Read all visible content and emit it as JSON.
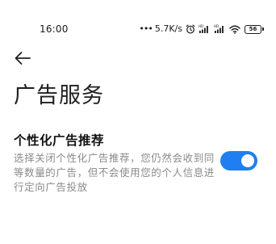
{
  "status_bar": {
    "time": "16:00",
    "dots": "•••",
    "net_speed": "5.7K/s",
    "alarm_icon": "alarm-icon",
    "signal_icons": [
      "signal-hd-icon",
      "signal-hd-icon"
    ],
    "wifi_icon": "wifi-icon",
    "battery_level": "56"
  },
  "header": {
    "back_icon": "back-arrow-icon",
    "title": "广告服务"
  },
  "setting": {
    "title": "个性化广告推荐",
    "description": "选择关闭个性化广告推荐，您仍然会收到同等数量的广告，但不会使用您的个人信息进行定向广告投放",
    "toggle_on": true,
    "accent_color": "#1f7ff0"
  }
}
